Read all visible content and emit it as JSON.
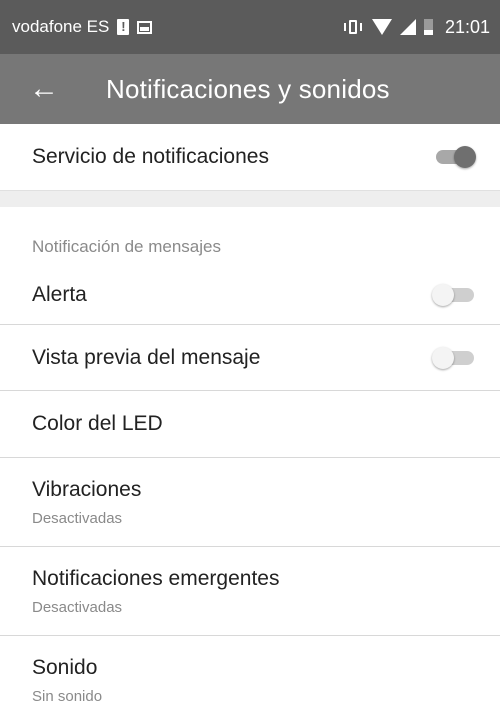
{
  "status_bar": {
    "carrier": "vodafone ES",
    "time": "21:01",
    "icons": [
      "alert-icon",
      "image-icon",
      "vibrate-icon",
      "wifi-icon",
      "signal-icon",
      "battery-icon"
    ]
  },
  "toolbar": {
    "back_icon": "←",
    "title": "Notificaciones y sonidos",
    "color": "#777777"
  },
  "service": {
    "label": "Servicio de notificaciones",
    "enabled": true
  },
  "section": {
    "header": "Notificación de mensajes"
  },
  "settings": {
    "alert": {
      "label": "Alerta",
      "enabled": false
    },
    "preview": {
      "label": "Vista previa del mensaje",
      "enabled": false
    },
    "led": {
      "label": "Color del LED"
    },
    "vibration": {
      "label": "Vibraciones",
      "value": "Desactivadas"
    },
    "popup": {
      "label": "Notificaciones emergentes",
      "value": "Desactivadas"
    },
    "sound": {
      "label": "Sonido",
      "value": "Sin sonido"
    }
  }
}
